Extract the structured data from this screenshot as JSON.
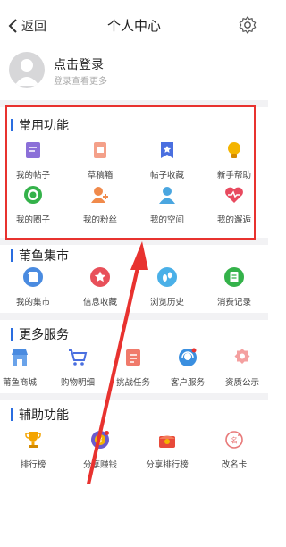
{
  "header": {
    "back_label": "返回",
    "title": "个人中心"
  },
  "profile": {
    "login_label": "点击登录",
    "login_sub": "登录查看更多"
  },
  "sections": [
    {
      "title": "常用功能",
      "items": [
        {
          "label": "我的帖子",
          "icon": "post-icon",
          "color": "#8b6fd8"
        },
        {
          "label": "草稿箱",
          "icon": "draft-icon",
          "color": "#f28b6b"
        },
        {
          "label": "帖子收藏",
          "icon": "bookmark-star-icon",
          "color": "#4a6fe0"
        },
        {
          "label": "新手帮助",
          "icon": "lightbulb-icon",
          "color": "#f4b400"
        },
        {
          "label": "我的圈子",
          "icon": "circle-target-icon",
          "color": "#34b24a"
        },
        {
          "label": "我的粉丝",
          "icon": "user-add-icon",
          "color": "#f08a4b"
        },
        {
          "label": "我的空间",
          "icon": "user-icon",
          "color": "#4aa6e0"
        },
        {
          "label": "我的邂逅",
          "icon": "heartbeat-icon",
          "color": "#e84a5f"
        }
      ]
    },
    {
      "title": "莆鱼集市",
      "items": [
        {
          "label": "我的集市",
          "icon": "market-icon",
          "color": "#4a8be0"
        },
        {
          "label": "信息收藏",
          "icon": "star-circle-icon",
          "color": "#e8505a"
        },
        {
          "label": "浏览历史",
          "icon": "footprint-icon",
          "color": "#4ab0e8"
        },
        {
          "label": "消费记录",
          "icon": "receipt-icon",
          "color": "#34b24a"
        }
      ]
    },
    {
      "title": "更多服务",
      "items": [
        {
          "label": "莆鱼商城",
          "icon": "shop-icon",
          "color": "#4a8be0"
        },
        {
          "label": "购物明细",
          "icon": "cart-icon",
          "color": "#4a6fe0"
        },
        {
          "label": "挑战任务",
          "icon": "task-icon",
          "color": "#f07a6b"
        },
        {
          "label": "客户服务",
          "icon": "customer-service-icon",
          "color": "#3a8fe0"
        },
        {
          "label": "资质公示",
          "icon": "certificate-icon",
          "color": "#f28b8b"
        }
      ]
    },
    {
      "title": "辅助功能",
      "items": [
        {
          "label": "排行榜",
          "icon": "trophy-icon",
          "color": "#f4a400"
        },
        {
          "label": "分享赚钱",
          "icon": "share-money-icon",
          "color": "#e85a4a"
        },
        {
          "label": "分享排行榜",
          "icon": "share-rank-icon",
          "color": "#e84a3a"
        },
        {
          "label": "改名卡",
          "icon": "rename-card-icon",
          "color": "#e87a7a"
        }
      ]
    }
  ],
  "accent_color": "#2a6de0",
  "annotation_color": "#e8322f"
}
